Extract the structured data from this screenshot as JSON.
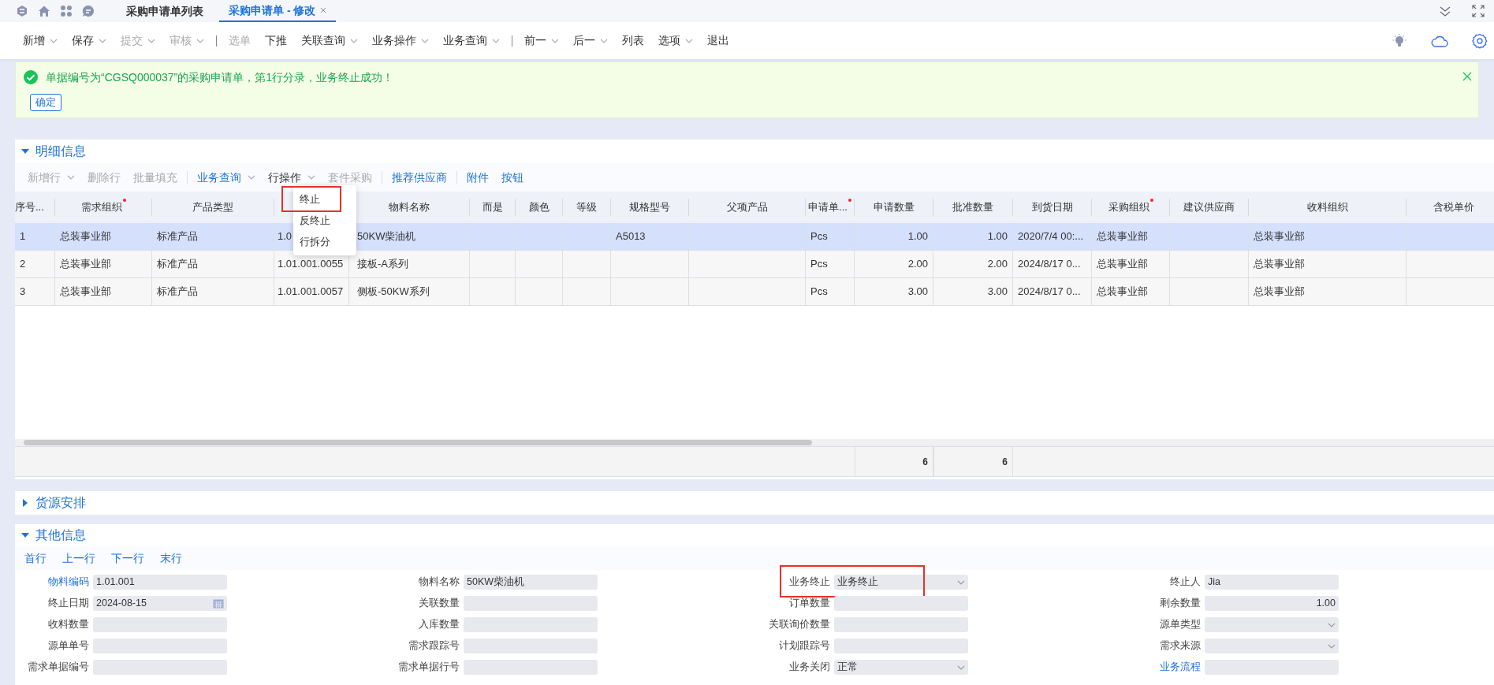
{
  "tabs": [
    {
      "label": "采购申请单列表",
      "selected": false
    },
    {
      "label": "采购申请单 - 修改",
      "selected": true
    }
  ],
  "toolbar": [
    {
      "kind": "button",
      "label": "新增",
      "dropdown": true,
      "disabled": false
    },
    {
      "kind": "button",
      "label": "保存",
      "dropdown": true,
      "disabled": false
    },
    {
      "kind": "button",
      "label": "提交",
      "dropdown": true,
      "disabled": true
    },
    {
      "kind": "button",
      "label": "审核",
      "dropdown": true,
      "disabled": true
    },
    {
      "kind": "separator"
    },
    {
      "kind": "button",
      "label": "选单",
      "dropdown": false,
      "disabled": true
    },
    {
      "kind": "button",
      "label": "下推",
      "dropdown": false,
      "disabled": false
    },
    {
      "kind": "button",
      "label": "关联查询",
      "dropdown": true,
      "disabled": false
    },
    {
      "kind": "button",
      "label": "业务操作",
      "dropdown": true,
      "disabled": false
    },
    {
      "kind": "button",
      "label": "业务查询",
      "dropdown": true,
      "disabled": false
    },
    {
      "kind": "separator"
    },
    {
      "kind": "button",
      "label": "前一",
      "dropdown": true,
      "disabled": false
    },
    {
      "kind": "button",
      "label": "后一",
      "dropdown": true,
      "disabled": false
    },
    {
      "kind": "button",
      "label": "列表",
      "dropdown": false,
      "disabled": false
    },
    {
      "kind": "button",
      "label": "选项",
      "dropdown": true,
      "disabled": false
    },
    {
      "kind": "button",
      "label": "退出",
      "dropdown": false,
      "disabled": false
    }
  ],
  "message": {
    "text": "单据编号为“CGSQ000037”的采购申请单，第1行分录，业务终止成功！",
    "button": "确定"
  },
  "detail": {
    "title": "明细信息",
    "expanded": true,
    "toolbar": [
      {
        "kind": "button",
        "label": "新增行",
        "dropdown": true,
        "disabled": true
      },
      {
        "kind": "button",
        "label": "删除行",
        "dropdown": false,
        "disabled": true
      },
      {
        "kind": "button",
        "label": "批量填充",
        "dropdown": false,
        "disabled": true
      },
      {
        "kind": "separator"
      },
      {
        "kind": "link",
        "label": "业务查询",
        "dropdown": true,
        "disabled": false
      },
      {
        "kind": "button",
        "label": "行操作",
        "dropdown": true,
        "disabled": false
      },
      {
        "kind": "button",
        "label": "套件采购",
        "dropdown": false,
        "disabled": true
      },
      {
        "kind": "separator"
      },
      {
        "kind": "link",
        "label": "推荐供应商",
        "dropdown": false,
        "disabled": false
      },
      {
        "kind": "separator"
      },
      {
        "kind": "link",
        "label": "附件",
        "dropdown": false,
        "disabled": false
      },
      {
        "kind": "link",
        "label": "按钮",
        "dropdown": false,
        "disabled": false
      }
    ],
    "row_menu": [
      {
        "label": "终止",
        "highlighted": true
      },
      {
        "label": "反终止",
        "highlighted": false
      },
      {
        "label": "行拆分",
        "highlighted": false
      }
    ],
    "columns": [
      {
        "label": "序号...",
        "kind": "text"
      },
      {
        "label": "需求组织",
        "required": true,
        "kind": "text"
      },
      {
        "label": "产品类型",
        "kind": "text"
      },
      {
        "kind": "text"
      },
      {
        "label": "物料名称",
        "kind": "text"
      },
      {
        "label": "而是",
        "kind": "text"
      },
      {
        "label": "颜色",
        "kind": "text"
      },
      {
        "label": "等级",
        "kind": "text"
      },
      {
        "label": "规格型号",
        "kind": "text"
      },
      {
        "label": "父项产品",
        "kind": "text"
      },
      {
        "label": "申请单...",
        "required": true,
        "kind": "text"
      },
      {
        "label": "申请数量",
        "kind": "number",
        "total": "6"
      },
      {
        "label": "批准数量",
        "kind": "number",
        "total": "6"
      },
      {
        "label": "到货日期",
        "kind": "text"
      },
      {
        "label": "采购组织",
        "required": true,
        "kind": "text"
      },
      {
        "label": "建议供应商",
        "kind": "text"
      },
      {
        "label": "收料组织",
        "kind": "text"
      },
      {
        "label": "含税单价",
        "kind": "number"
      }
    ],
    "rows": [
      {
        "selected": true,
        "cells": [
          "1",
          "总装事业部",
          "标准产品",
          "1.0",
          "50KW柴油机",
          null,
          null,
          null,
          "A5013",
          null,
          "Pcs",
          "1.00",
          "1.00",
          "2020/7/4 00:...",
          "总装事业部",
          null,
          "总装事业部",
          null
        ]
      },
      {
        "selected": false,
        "cells": [
          "2",
          "总装事业部",
          "标准产品",
          "1.01.001.0055",
          "接板-A系列",
          null,
          null,
          null,
          null,
          null,
          "Pcs",
          "2.00",
          "2.00",
          "2024/8/17 0...",
          "总装事业部",
          null,
          "总装事业部",
          null
        ]
      },
      {
        "selected": false,
        "cells": [
          "3",
          "总装事业部",
          "标准产品",
          "1.01.001.0057",
          "侧板-50KW系列",
          null,
          null,
          null,
          null,
          null,
          "Pcs",
          "3.00",
          "3.00",
          "2024/8/17 0...",
          "总装事业部",
          null,
          "总装事业部",
          null
        ]
      }
    ]
  },
  "source_section": {
    "title": "货源安排",
    "expanded": false
  },
  "other": {
    "title": "其他信息",
    "expanded": true,
    "nav": [
      "首行",
      "上一行",
      "下一行",
      "末行"
    ],
    "fields": [
      {
        "label": "物料编码",
        "value": "1.01.001",
        "kind": "text",
        "link": true,
        "highlighted": false
      },
      {
        "label": "物料名称",
        "value": "50KW柴油机",
        "kind": "text",
        "link": false,
        "highlighted": false
      },
      {
        "label": "业务终止",
        "value": "业务终止",
        "kind": "select",
        "link": false,
        "highlighted": true
      },
      {
        "label": "终止人",
        "value": "Jia",
        "kind": "text",
        "link": false,
        "highlighted": false
      },
      {
        "label": "终止日期",
        "value": "2024-08-15",
        "kind": "date",
        "link": false,
        "highlighted": false
      },
      {
        "label": "关联数量",
        "kind": "text",
        "link": false,
        "highlighted": false
      },
      {
        "label": "订单数量",
        "kind": "text",
        "link": false,
        "highlighted": false
      },
      {
        "label": "剩余数量",
        "value": "1.00",
        "kind": "number",
        "link": false,
        "highlighted": false
      },
      {
        "label": "收料数量",
        "kind": "text",
        "link": false,
        "highlighted": false
      },
      {
        "label": "入库数量",
        "kind": "text",
        "link": false,
        "highlighted": false
      },
      {
        "label": "关联询价数量",
        "kind": "text",
        "link": false,
        "highlighted": false
      },
      {
        "label": "源单类型",
        "kind": "select",
        "link": false,
        "highlighted": false
      },
      {
        "label": "源单单号",
        "kind": "text",
        "link": false,
        "highlighted": false
      },
      {
        "label": "需求跟踪号",
        "kind": "text",
        "link": false,
        "highlighted": false
      },
      {
        "label": "计划跟踪号",
        "kind": "text",
        "link": false,
        "highlighted": false
      },
      {
        "label": "需求来源",
        "kind": "select",
        "link": false,
        "highlighted": false
      },
      {
        "label": "需求单据编号",
        "kind": "text",
        "link": false,
        "highlighted": false
      },
      {
        "label": "需求单据行号",
        "kind": "text",
        "link": false,
        "highlighted": false
      },
      {
        "label": "业务关闭",
        "value": "正常",
        "kind": "select",
        "link": false,
        "highlighted": false
      },
      {
        "label": "业务流程",
        "kind": "text",
        "link": true,
        "highlighted": false
      }
    ]
  }
}
